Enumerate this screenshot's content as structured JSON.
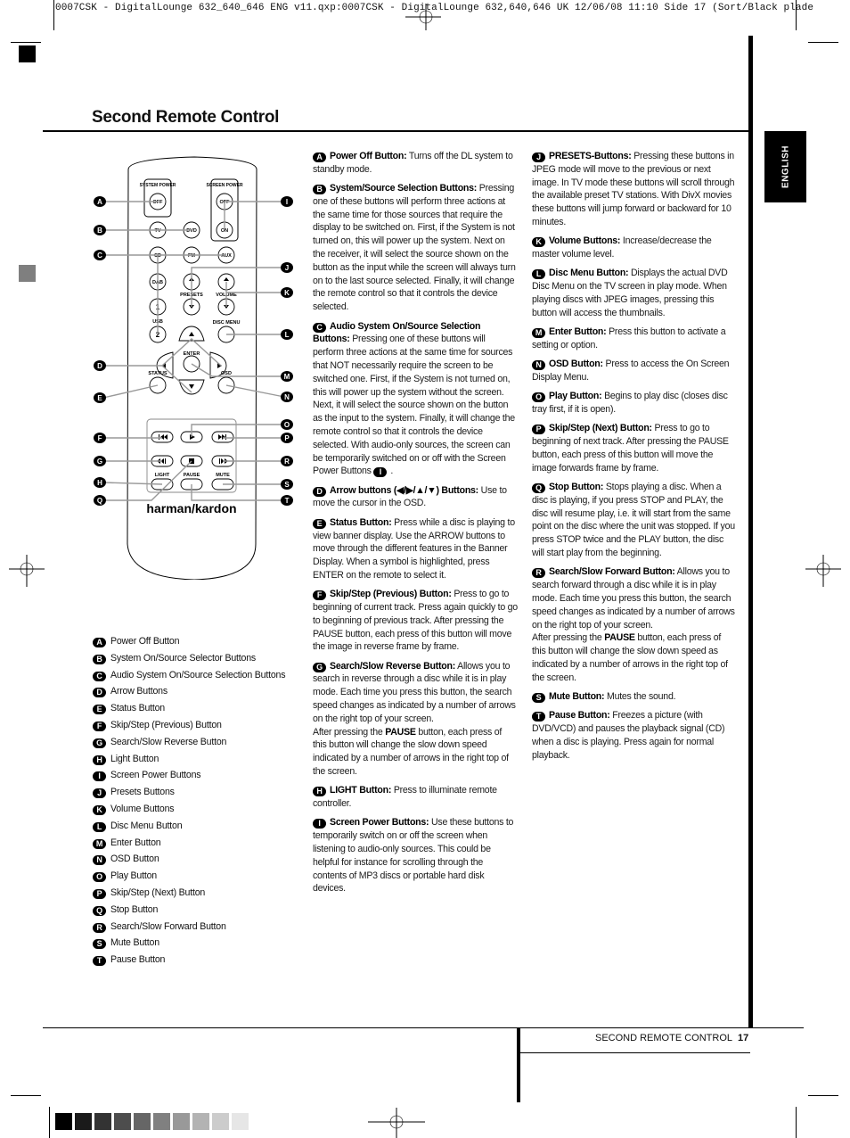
{
  "slug": "0007CSK - DigitalLounge 632_640_646 ENG v11.qxp:0007CSK - DigitalLounge 632,640,646 UK  12/06/08  11:10  Side 17     (Sort/Black plade",
  "page_title": "Second Remote Control",
  "language_tab": "ENGLISH",
  "remote": {
    "brand": "harman/kardon",
    "labels": {
      "system_power": "SYSTEM POWER",
      "screen_power": "SCREEN POWER",
      "off": "OFF",
      "on": "ON",
      "tv": "TV",
      "dvd": "DVD",
      "cd": "CD",
      "fm": "FM",
      "aux": "AUX",
      "dab": "DAB",
      "presets": "PRESETS",
      "volume": "VOLUME",
      "usb": "USB",
      "one": "1",
      "two": "2",
      "disc_menu": "DISC MENU",
      "enter": "ENTER",
      "status": "STATUS",
      "osd": "OSD",
      "light": "LIGHT",
      "pause": "PAUSE",
      "mute": "MUTE"
    },
    "callouts_left": [
      "A",
      "B",
      "C",
      "D",
      "E",
      "F",
      "G",
      "H",
      "Q"
    ],
    "callouts_right": [
      "I",
      "J",
      "K",
      "L",
      "M",
      "N",
      "O",
      "P",
      "R",
      "S",
      "T"
    ]
  },
  "legend": [
    {
      "key": "A",
      "label": "Power Off Button"
    },
    {
      "key": "B",
      "label": "System On/Source Selector Buttons"
    },
    {
      "key": "C",
      "label": "Audio System On/Source Selection Buttons"
    },
    {
      "key": "D",
      "label": "Arrow Buttons"
    },
    {
      "key": "E",
      "label": "Status Button"
    },
    {
      "key": "F",
      "label": "Skip/Step (Previous) Button"
    },
    {
      "key": "G",
      "label": "Search/Slow Reverse Button"
    },
    {
      "key": "H",
      "label": "Light Button"
    },
    {
      "key": "I",
      "label": "Screen Power Buttons"
    },
    {
      "key": "J",
      "label": "Presets Buttons"
    },
    {
      "key": "K",
      "label": "Volume Buttons"
    },
    {
      "key": "L",
      "label": "Disc Menu Button"
    },
    {
      "key": "M",
      "label": "Enter Button"
    },
    {
      "key": "N",
      "label": "OSD Button"
    },
    {
      "key": "O",
      "label": "Play Button"
    },
    {
      "key": "P",
      "label": "Skip/Step (Next) Button"
    },
    {
      "key": "Q",
      "label": "Stop Button"
    },
    {
      "key": "R",
      "label": "Search/Slow Forward Button"
    },
    {
      "key": "S",
      "label": "Mute Button"
    },
    {
      "key": "T",
      "label": "Pause Button"
    }
  ],
  "descriptions_col1": [
    {
      "key": "A",
      "title": "Power Off Button:",
      "text": " Turns off the DL system to standby mode."
    },
    {
      "key": "B",
      "title": "System/Source Selection Buttons:",
      "text": " Pressing one of these buttons will perform three actions at the same time for those sources that require the display to be switched on. First, if the System is not turned on, this will power up the system. Next on the receiver, it will select the source shown on the button as the input while the screen will always turn on to the last source selected. Finally, it will change the remote control so that it controls the device selected."
    },
    {
      "key": "C",
      "title": "Audio System On/Source Selection Buttons:",
      "text": " Pressing one of these buttons will perform three actions at the same time for sources that NOT necessarily require the screen to be switched one. First, if the System is not turned on, this will power up the system without the screen. Next, it will select the source shown on the button as the input to the system. Finally, it will change the remote control so that it controls the device selected. With audio-only sources, the screen can be temporarily switched on or off with the Screen Power Buttons ",
      "ref": "I",
      "tail": "."
    },
    {
      "key": "D",
      "title": "Arrow buttons (◀/▶/▲/▼) Buttons:",
      "text": " Use to move the cursor in the OSD."
    },
    {
      "key": "E",
      "title": "Status Button:",
      "text": " Press while a disc is playing to view banner display. Use the ARROW buttons to move through the different features in the Banner Display. When a symbol is highlighted, press ENTER on the remote to select it."
    },
    {
      "key": "F",
      "title": "Skip/Step (Previous) Button:",
      "text": " Press to go to beginning of current track. Press again quickly to go to beginning of previous track. After pressing the PAUSE button, each press of this button will move the image in reverse frame by frame."
    },
    {
      "key": "G",
      "title": "Search/Slow Reverse Button:",
      "text": " Allows you to search in reverse through a disc while it is in play mode. Each time you press this button, the search speed changes as indicated by a number of arrows on the right top of your screen.",
      "text2a": "After pressing the ",
      "bold2": "PAUSE",
      "text2b": " button, each press of this button will change the slow down speed indicated by a number of arrows in the right top of the screen."
    },
    {
      "key": "H",
      "title": "LIGHT Button:",
      "text": " Press to illuminate remote controller."
    },
    {
      "key": "I",
      "title": "Screen Power Buttons:",
      "text": " Use these buttons to temporarily switch on or off the screen when listening to audio-only sources. This could be helpful for instance for scrolling through the contents of MP3 discs or portable hard disk devices."
    }
  ],
  "descriptions_col2": [
    {
      "key": "J",
      "title": "PRESETS-Buttons:",
      "text": " Pressing these buttons in JPEG mode will move to the previous or next image. In TV mode these buttons will scroll through the available preset TV stations. With DivX movies these buttons will jump forward or backward for 10 minutes."
    },
    {
      "key": "K",
      "title": "Volume Buttons:",
      "text": " Increase/decrease the master volume level."
    },
    {
      "key": "L",
      "title": "Disc Menu Button:",
      "text": " Displays the actual DVD Disc Menu on the TV screen in play mode. When playing discs with JPEG images, pressing this button will access the thumbnails."
    },
    {
      "key": "M",
      "title": "Enter Button:",
      "text": " Press this button to activate a setting or option."
    },
    {
      "key": "N",
      "title": "OSD Button:",
      "text": " Press to access the On Screen Display Menu."
    },
    {
      "key": "O",
      "title": "Play Button:",
      "text": " Begins to play disc (closes disc tray first, if it is open)."
    },
    {
      "key": "P",
      "title": "Skip/Step (Next) Button:",
      "text": " Press to go to beginning of next track. After pressing the PAUSE button, each press of this button will move the image forwards frame by frame."
    },
    {
      "key": "Q",
      "title": "Stop Button:",
      "text": " Stops playing a disc. When a disc is playing, if you press STOP and PLAY, the disc will resume play, i.e. it will start from the same point on the disc where the unit was stopped. If you press STOP twice and the PLAY button, the disc will start play from the beginning."
    },
    {
      "key": "R",
      "title": "Search/Slow Forward Button:",
      "text": " Allows you to search forward through a disc while it is in play mode. Each time you press this button, the search speed changes as indicated by a number of arrows on the right top of your screen.",
      "text2a": "After pressing the ",
      "bold2": "PAUSE",
      "text2b": " button, each press of this button will change the slow down speed as indicated by a number of arrows in the right top of the screen."
    },
    {
      "key": "S",
      "title": "Mute Button:",
      "text": " Mutes the sound."
    },
    {
      "key": "T",
      "title": "Pause Button:",
      "text": " Freezes a picture (with DVD/VCD) and pauses the playback signal (CD) when a disc is playing. Press again for normal playback."
    }
  ],
  "footer": {
    "section": "SECOND REMOTE CONTROL",
    "page_number": "17"
  },
  "colors": {
    "swatches": [
      "#000000",
      "#1a1a1a",
      "#333333",
      "#4d4d4d",
      "#666666",
      "#808080",
      "#999999",
      "#b3b3b3",
      "#cccccc",
      "#e6e6e6"
    ],
    "margin_mark_grey": "#7f7f7f"
  }
}
